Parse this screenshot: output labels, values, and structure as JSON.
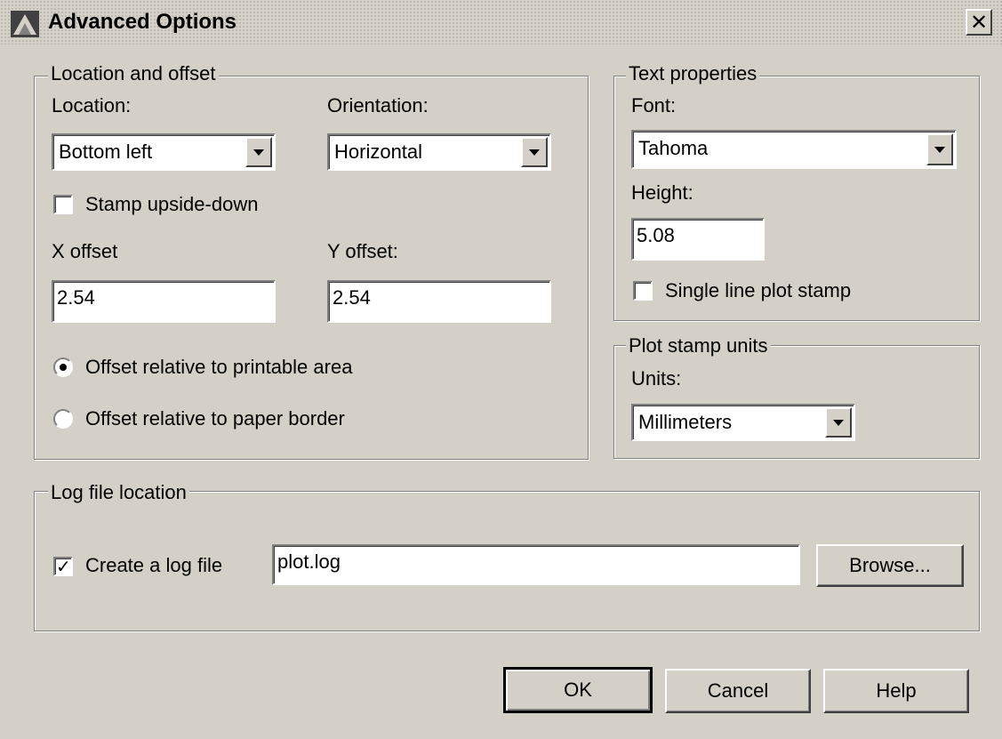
{
  "window": {
    "title": "Advanced Options",
    "close_label": "✕"
  },
  "location_offset": {
    "legend": "Location and offset",
    "location_label": "Location:",
    "location_value": "Bottom left",
    "orientation_label": "Orientation:",
    "orientation_value": "Horizontal",
    "stamp_upside_down_label": "Stamp upside-down",
    "stamp_upside_down_checked": false,
    "x_offset_label": "X offset",
    "x_offset_value": "2.54",
    "y_offset_label": "Y offset:",
    "y_offset_value": "2.54",
    "radio_printable_label": "Offset relative to printable area",
    "radio_paper_label": "Offset relative to paper border",
    "selected_radio": "printable"
  },
  "text_properties": {
    "legend": "Text properties",
    "font_label": "Font:",
    "font_value": "Tahoma",
    "height_label": "Height:",
    "height_value": "5.08",
    "single_line_label": "Single line plot stamp",
    "single_line_checked": false
  },
  "plot_stamp_units": {
    "legend": "Plot stamp units",
    "units_label": "Units:",
    "units_value": "Millimeters"
  },
  "log_file": {
    "legend": "Log file location",
    "create_label": "Create a log file",
    "create_checked": true,
    "filename": "plot.log",
    "browse_label": "Browse..."
  },
  "buttons": {
    "ok": "OK",
    "cancel": "Cancel",
    "help": "Help"
  }
}
